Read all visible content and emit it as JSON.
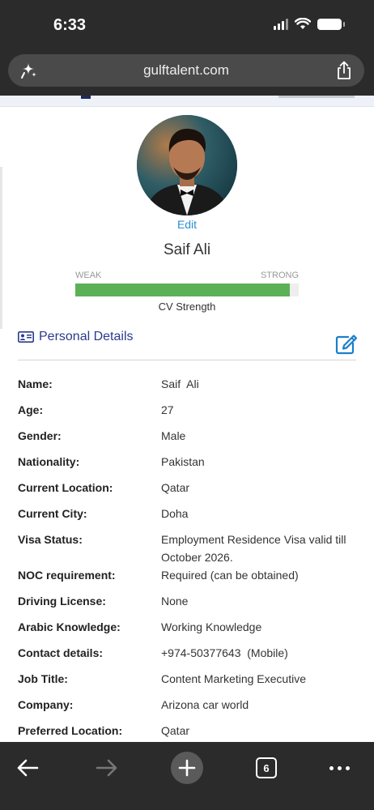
{
  "status_bar": {
    "time": "6:33"
  },
  "browser": {
    "url": "gulftalent.com",
    "open_tabs_count": "6"
  },
  "profile": {
    "edit_label": "Edit",
    "name": "Saif Ali",
    "cv_strength": {
      "weak_label": "WEAK",
      "strong_label": "STRONG",
      "caption": "CV Strength",
      "level_percent": 96,
      "fill_color": "#5cb157"
    }
  },
  "personal_details": {
    "title": "Personal Details",
    "rows": [
      {
        "label": "Name:",
        "value": "Saif  Ali"
      },
      {
        "label": "Age:",
        "value": "27"
      },
      {
        "label": "Gender:",
        "value": "Male"
      },
      {
        "label": "Nationality:",
        "value": "Pakistan"
      },
      {
        "label": "Current Location:",
        "value": "Qatar"
      },
      {
        "label": "Current City:",
        "value": "Doha"
      },
      {
        "label": "Visa Status:",
        "value": "Employment Residence Visa valid till October 2026."
      },
      {
        "label": "NOC requirement:",
        "value": "Required (can be obtained)"
      },
      {
        "label": "Driving License:",
        "value": "None"
      },
      {
        "label": "Arabic Knowledge:",
        "value": "Working Knowledge"
      },
      {
        "label": "Contact details:",
        "value": "+974-50377643  (Mobile)"
      },
      {
        "label": "Job Title:",
        "value": "Content Marketing Executive"
      },
      {
        "label": "Company:",
        "value": "Arizona car world"
      },
      {
        "label": "Preferred Location:",
        "value": "Qatar"
      }
    ]
  },
  "colors": {
    "accent_blue": "#2b3a8c",
    "link_blue": "#2a8fd6",
    "edit_icon_blue": "#1a7fc8"
  },
  "icons": {
    "url_left": "sparkle-icon",
    "url_right": "share-icon",
    "section": "id-card-icon",
    "section_action": "edit-pencil-icon",
    "nav": [
      "back-arrow-icon",
      "forward-arrow-icon",
      "plus-icon",
      "tabs-icon",
      "more-icon"
    ]
  }
}
